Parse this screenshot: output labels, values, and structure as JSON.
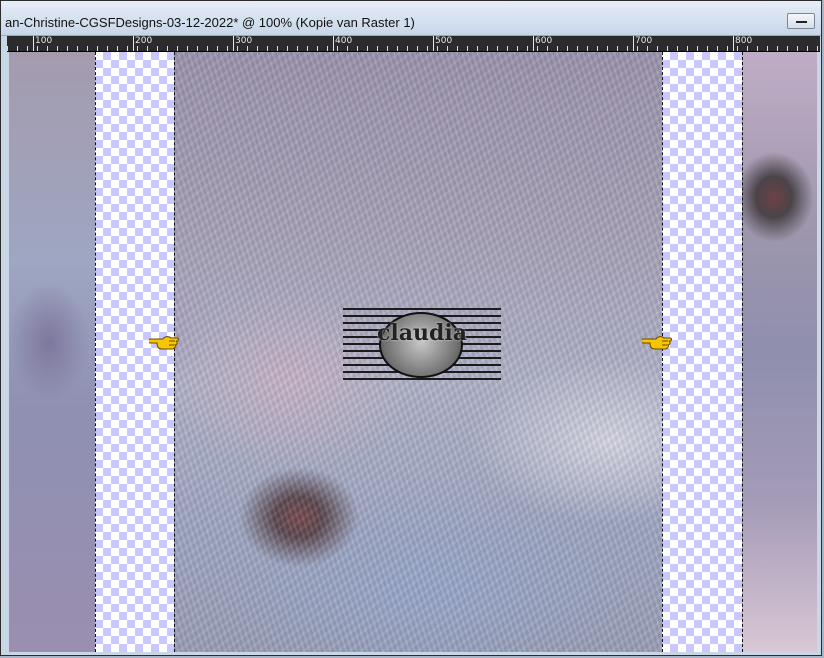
{
  "window": {
    "title": "an-Christine-CGSFDesigns-03-12-2022* @ 100% (Kopie van Raster 1)"
  },
  "ruler": {
    "labels": [
      "100",
      "200",
      "300",
      "400",
      "500",
      "600",
      "700",
      "800"
    ]
  },
  "canvas": {
    "watermark_text": "claudia",
    "icons": [
      "pointing-hand-icon",
      "pointing-hand-icon"
    ]
  },
  "colors": {
    "checker": "#c8c8ff",
    "pointer": "#f7c600"
  }
}
